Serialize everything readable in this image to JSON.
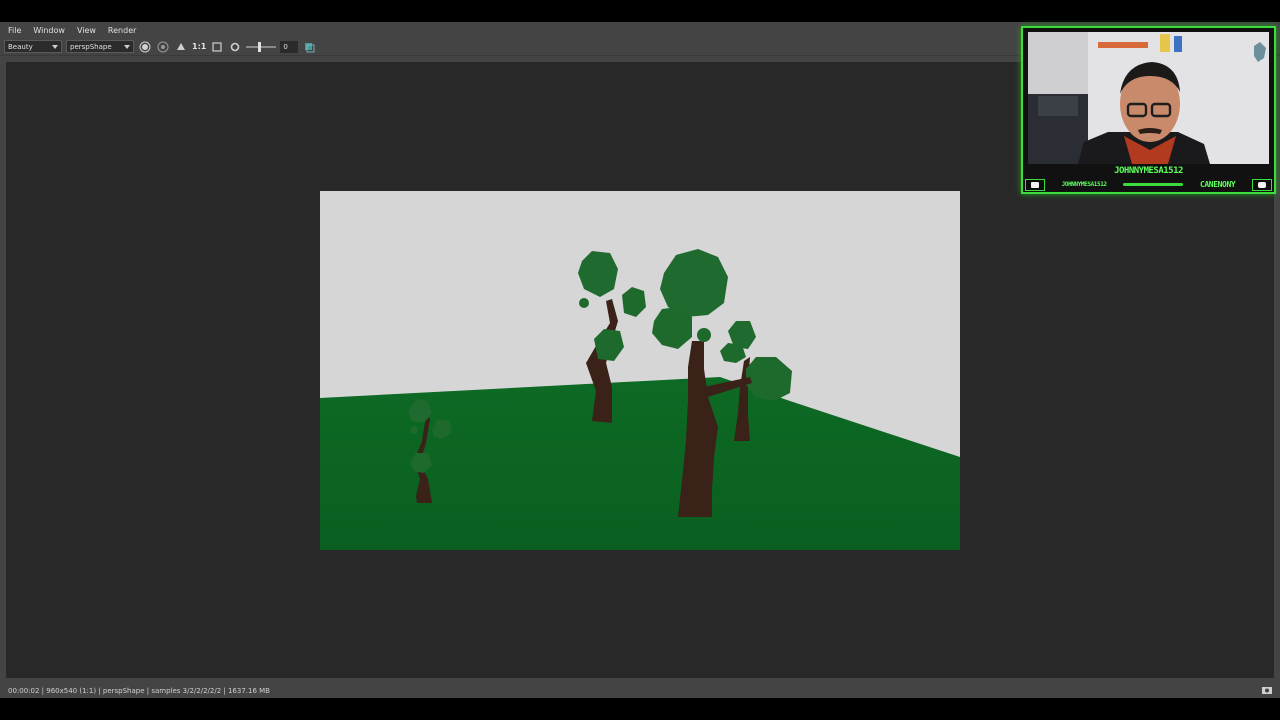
{
  "app": {
    "menu": [
      "File",
      "Window",
      "View",
      "Render"
    ],
    "toolbar": {
      "render_layer": "Beauty",
      "camera": "perspShape",
      "ratio_label": "1:1",
      "exposure_value": "0",
      "icons": [
        "snapshot-icon",
        "rgb-icon",
        "compare-icon",
        "ratio-label",
        "crop-icon",
        "settings-icon",
        "log-icon"
      ]
    },
    "status": {
      "text": "00:00:02 | 960x540 (1:1) | perspShape  | samples 3/2/2/2/2/2 | 1637.16 MB"
    },
    "colors": {
      "sky": "#d6d6d6",
      "ground": "#0b6d24",
      "foliage": "#1f6a2e",
      "trunk": "#3a2218",
      "webcam_accent": "#3ddc3d"
    }
  },
  "webcam": {
    "name": "JOHNNYMESA1512",
    "handle_left": "JOHNNYMESA1512",
    "handle_right": "CANENONY",
    "icons": [
      "twitch-icon",
      "youtube-icon"
    ]
  }
}
